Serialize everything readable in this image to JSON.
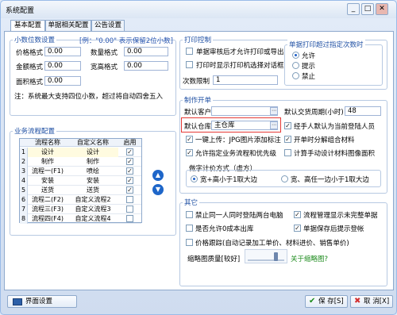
{
  "window": {
    "title": "系统配置",
    "minimize": "_",
    "maximize": "□",
    "close": "✕"
  },
  "tabs": [
    "基本配置",
    "单据相关配置",
    "公告设置"
  ],
  "decimal": {
    "title": "小数位数设置",
    "hint": "[例：\"0.00\" 表示保留2位小数]",
    "price_label": "价格格式",
    "price_value": "0.00",
    "qty_label": "数量格式",
    "qty_value": "0.00",
    "amount_label": "金额格式",
    "amount_value": "0.00",
    "width_label": "宽高格式",
    "width_value": "0.00",
    "area_label": "面积格式",
    "area_value": "0.00",
    "note": "注：系统最大支持四位小数，超过将自动四舍五入"
  },
  "print": {
    "title": "打印控制",
    "opt1": "单据审核后才允许打印或导出",
    "opt2": "打印时显示打印机选择对话框",
    "copies_label": "次数限制",
    "copies_value": "1",
    "limit_title": "单据打印超过指定次数时",
    "radio_allow": "允许",
    "radio_prompt": "提示",
    "radio_forbid": "禁止"
  },
  "production": {
    "title": "制作开单",
    "default_customer_label": "默认客户",
    "default_customer_value": "",
    "delivery_label": "默认交货周期(小时)",
    "delivery_value": "48",
    "default_warehouse_label": "默认仓库",
    "default_warehouse_value": "主仓库",
    "opt_handler": "经手人默认为当前登陆人员",
    "opt_jpg": "一键上传：JPG图片添加标注",
    "opt_decompose": "开单时分解组合材料",
    "opt_flow_priority": "允许指定业务流程和优先级",
    "opt_calc_image_area": "计算手动设计材料图像面积",
    "calc_mode_title": "做字计价方式（虚方）",
    "calc_mode_a": "宽+高小于1取大边",
    "calc_mode_b": "宽、高任一边小于1取大边"
  },
  "flow": {
    "title": "业务流程配置",
    "headers": [
      "流程名称",
      "自定义名称",
      "启用"
    ],
    "rows": [
      {
        "n": "1",
        "name": "设计",
        "custom": "设计",
        "on": true
      },
      {
        "n": "2",
        "name": "制作",
        "custom": "制作",
        "on": true
      },
      {
        "n": "3",
        "name": "流程一(F1)",
        "custom": "喷绘",
        "on": true
      },
      {
        "n": "4",
        "name": "安装",
        "custom": "安装",
        "on": true
      },
      {
        "n": "5",
        "name": "送货",
        "custom": "送货",
        "on": true
      },
      {
        "n": "6",
        "name": "流程二(F2)",
        "custom": "自定义流程2",
        "on": false
      },
      {
        "n": "7",
        "name": "流程三(F3)",
        "custom": "自定义流程3",
        "on": false
      },
      {
        "n": "8",
        "name": "流程四(F4)",
        "custom": "自定义流程4",
        "on": false
      }
    ],
    "up": "▲",
    "down": "▼"
  },
  "other": {
    "title": "其它",
    "opt1": "禁止同一人同时登陆两台电脑",
    "opt2": "流程管理显示未完整单据",
    "opt3": "是否允许0成本出库",
    "opt4": "单据保存后提示登帐",
    "opt5": "价格跟踪(自动记录加工单价、材料进价、销售单价)",
    "quality_label": "缩略图质量[较好]",
    "quality_link": "关于缩略图?"
  },
  "footer": {
    "interface": "界面设置",
    "save": "保 存[S]",
    "cancel": "取 消[X]"
  }
}
